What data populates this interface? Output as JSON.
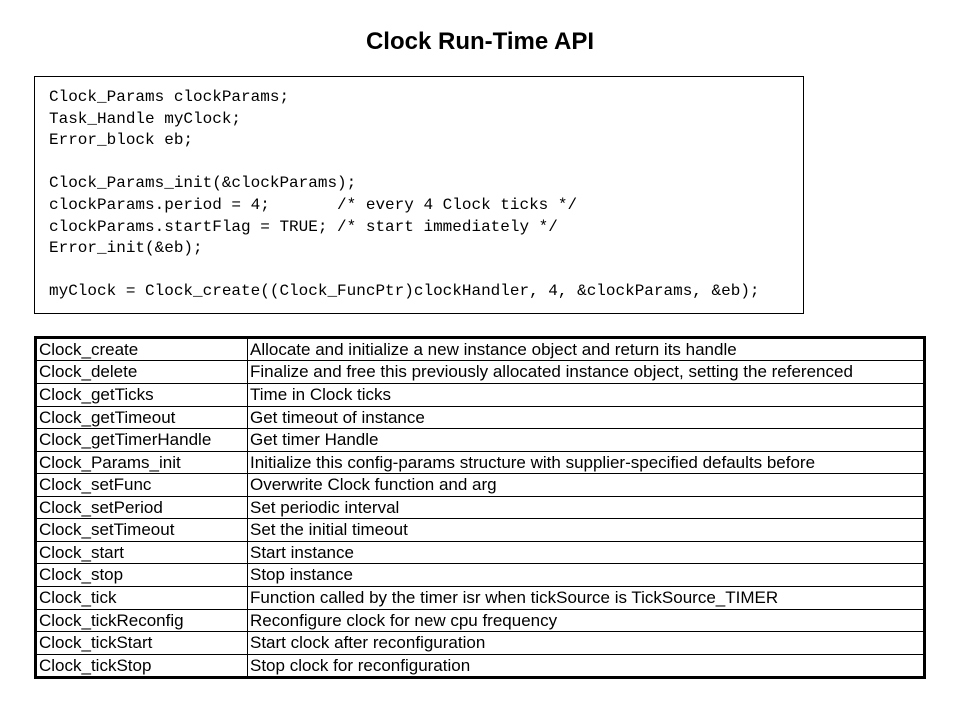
{
  "title": "Clock Run-Time API",
  "code_lines": [
    "Clock_Params clockParams;",
    "Task_Handle myClock;",
    "Error_block eb;",
    "",
    "Clock_Params_init(&clockParams);",
    "clockParams.period = 4;       /* every 4 Clock ticks */",
    "clockParams.startFlag = TRUE; /* start immediately */",
    "Error_init(&eb);",
    "",
    "myClock = Clock_create((Clock_FuncPtr)clockHandler, 4, &clockParams, &eb);"
  ],
  "api": [
    {
      "name": "Clock_create",
      "desc": "Allocate and initialize a new instance object and return its handle"
    },
    {
      "name": "Clock_delete",
      "desc": "Finalize and free this previously allocated instance object, setting the referenced"
    },
    {
      "name": "Clock_getTicks",
      "desc": "Time in Clock ticks"
    },
    {
      "name": "Clock_getTimeout",
      "desc": "Get timeout of instance"
    },
    {
      "name": "Clock_getTimerHandle",
      "desc": "Get timer Handle"
    },
    {
      "name": "Clock_Params_init",
      "desc": "Initialize this config-params structure with supplier-specified defaults before"
    },
    {
      "name": "Clock_setFunc",
      "desc": "Overwrite Clock function and arg"
    },
    {
      "name": "Clock_setPeriod",
      "desc": "Set periodic interval"
    },
    {
      "name": "Clock_setTimeout",
      "desc": "Set the initial timeout"
    },
    {
      "name": "Clock_start",
      "desc": "Start instance"
    },
    {
      "name": "Clock_stop",
      "desc": "Stop instance"
    },
    {
      "name": "Clock_tick",
      "desc": "Function called by the timer isr when tickSource is TickSource_TIMER"
    },
    {
      "name": "Clock_tickReconfig",
      "desc": "Reconfigure clock for new cpu frequency"
    },
    {
      "name": "Clock_tickStart",
      "desc": "Start clock after reconfiguration"
    },
    {
      "name": "Clock_tickStop",
      "desc": "Stop clock for reconfiguration"
    }
  ]
}
